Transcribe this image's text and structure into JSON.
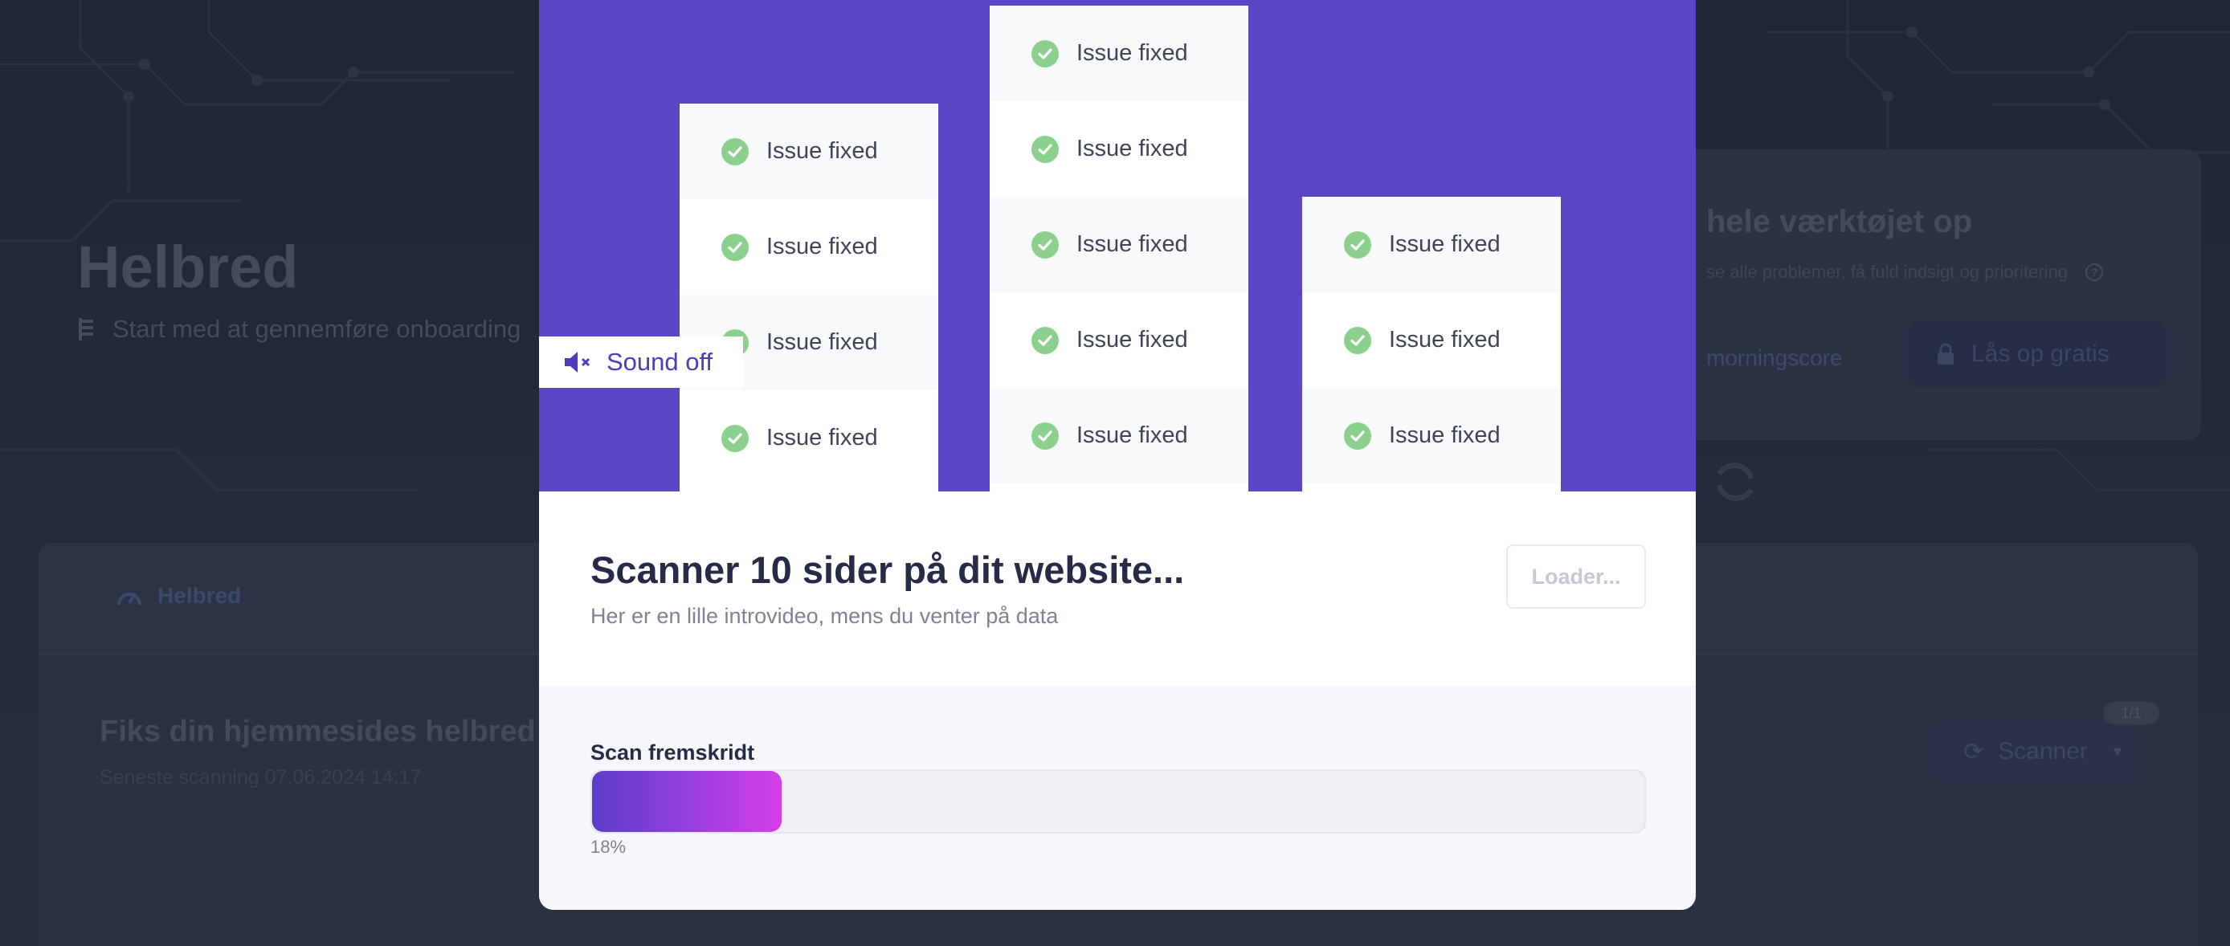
{
  "background": {
    "page_title": "Helbred",
    "subtitle": "Start med at gennemføre onboarding",
    "unlock_card": {
      "title": "hele værktøjet op",
      "description": "se alle problemer, få fuld indsigt og prioritering",
      "link": "morningscore",
      "button": "Lås op gratis"
    },
    "main_card": {
      "tab": "Helbred",
      "title": "Fiks din hjemmesides helbred",
      "date": "Seneste scanning 07.06.2024 14:17",
      "scan_button": "Scanner",
      "badge": "1/1"
    }
  },
  "modal": {
    "video": {
      "sound_button": "Sound off",
      "columns": [
        {
          "items": [
            "Issue fixed",
            "Issue fixed",
            "Issue fixed",
            "Issue fixed"
          ]
        },
        {
          "items": [
            "Issue fixed",
            "Issue fixed",
            "Issue fixed",
            "Issue fixed",
            "Issue fixed"
          ]
        },
        {
          "items": [
            "Issue fixed",
            "Issue fixed",
            "Issue fixed"
          ]
        }
      ]
    },
    "title": "Scanner 10 sider på dit website...",
    "subtitle": "Her er en lille introvideo, mens du venter på data",
    "loader_button": "Loader...",
    "progress": {
      "label": "Scan fremskridt",
      "value": 18,
      "percent_text": "18%"
    }
  },
  "colors": {
    "video_bg": "#5d45c8",
    "check_green": "#8cd08e",
    "progress_start": "#5a3ec8",
    "progress_end": "#d63ee8",
    "title_dark": "#262c48"
  }
}
